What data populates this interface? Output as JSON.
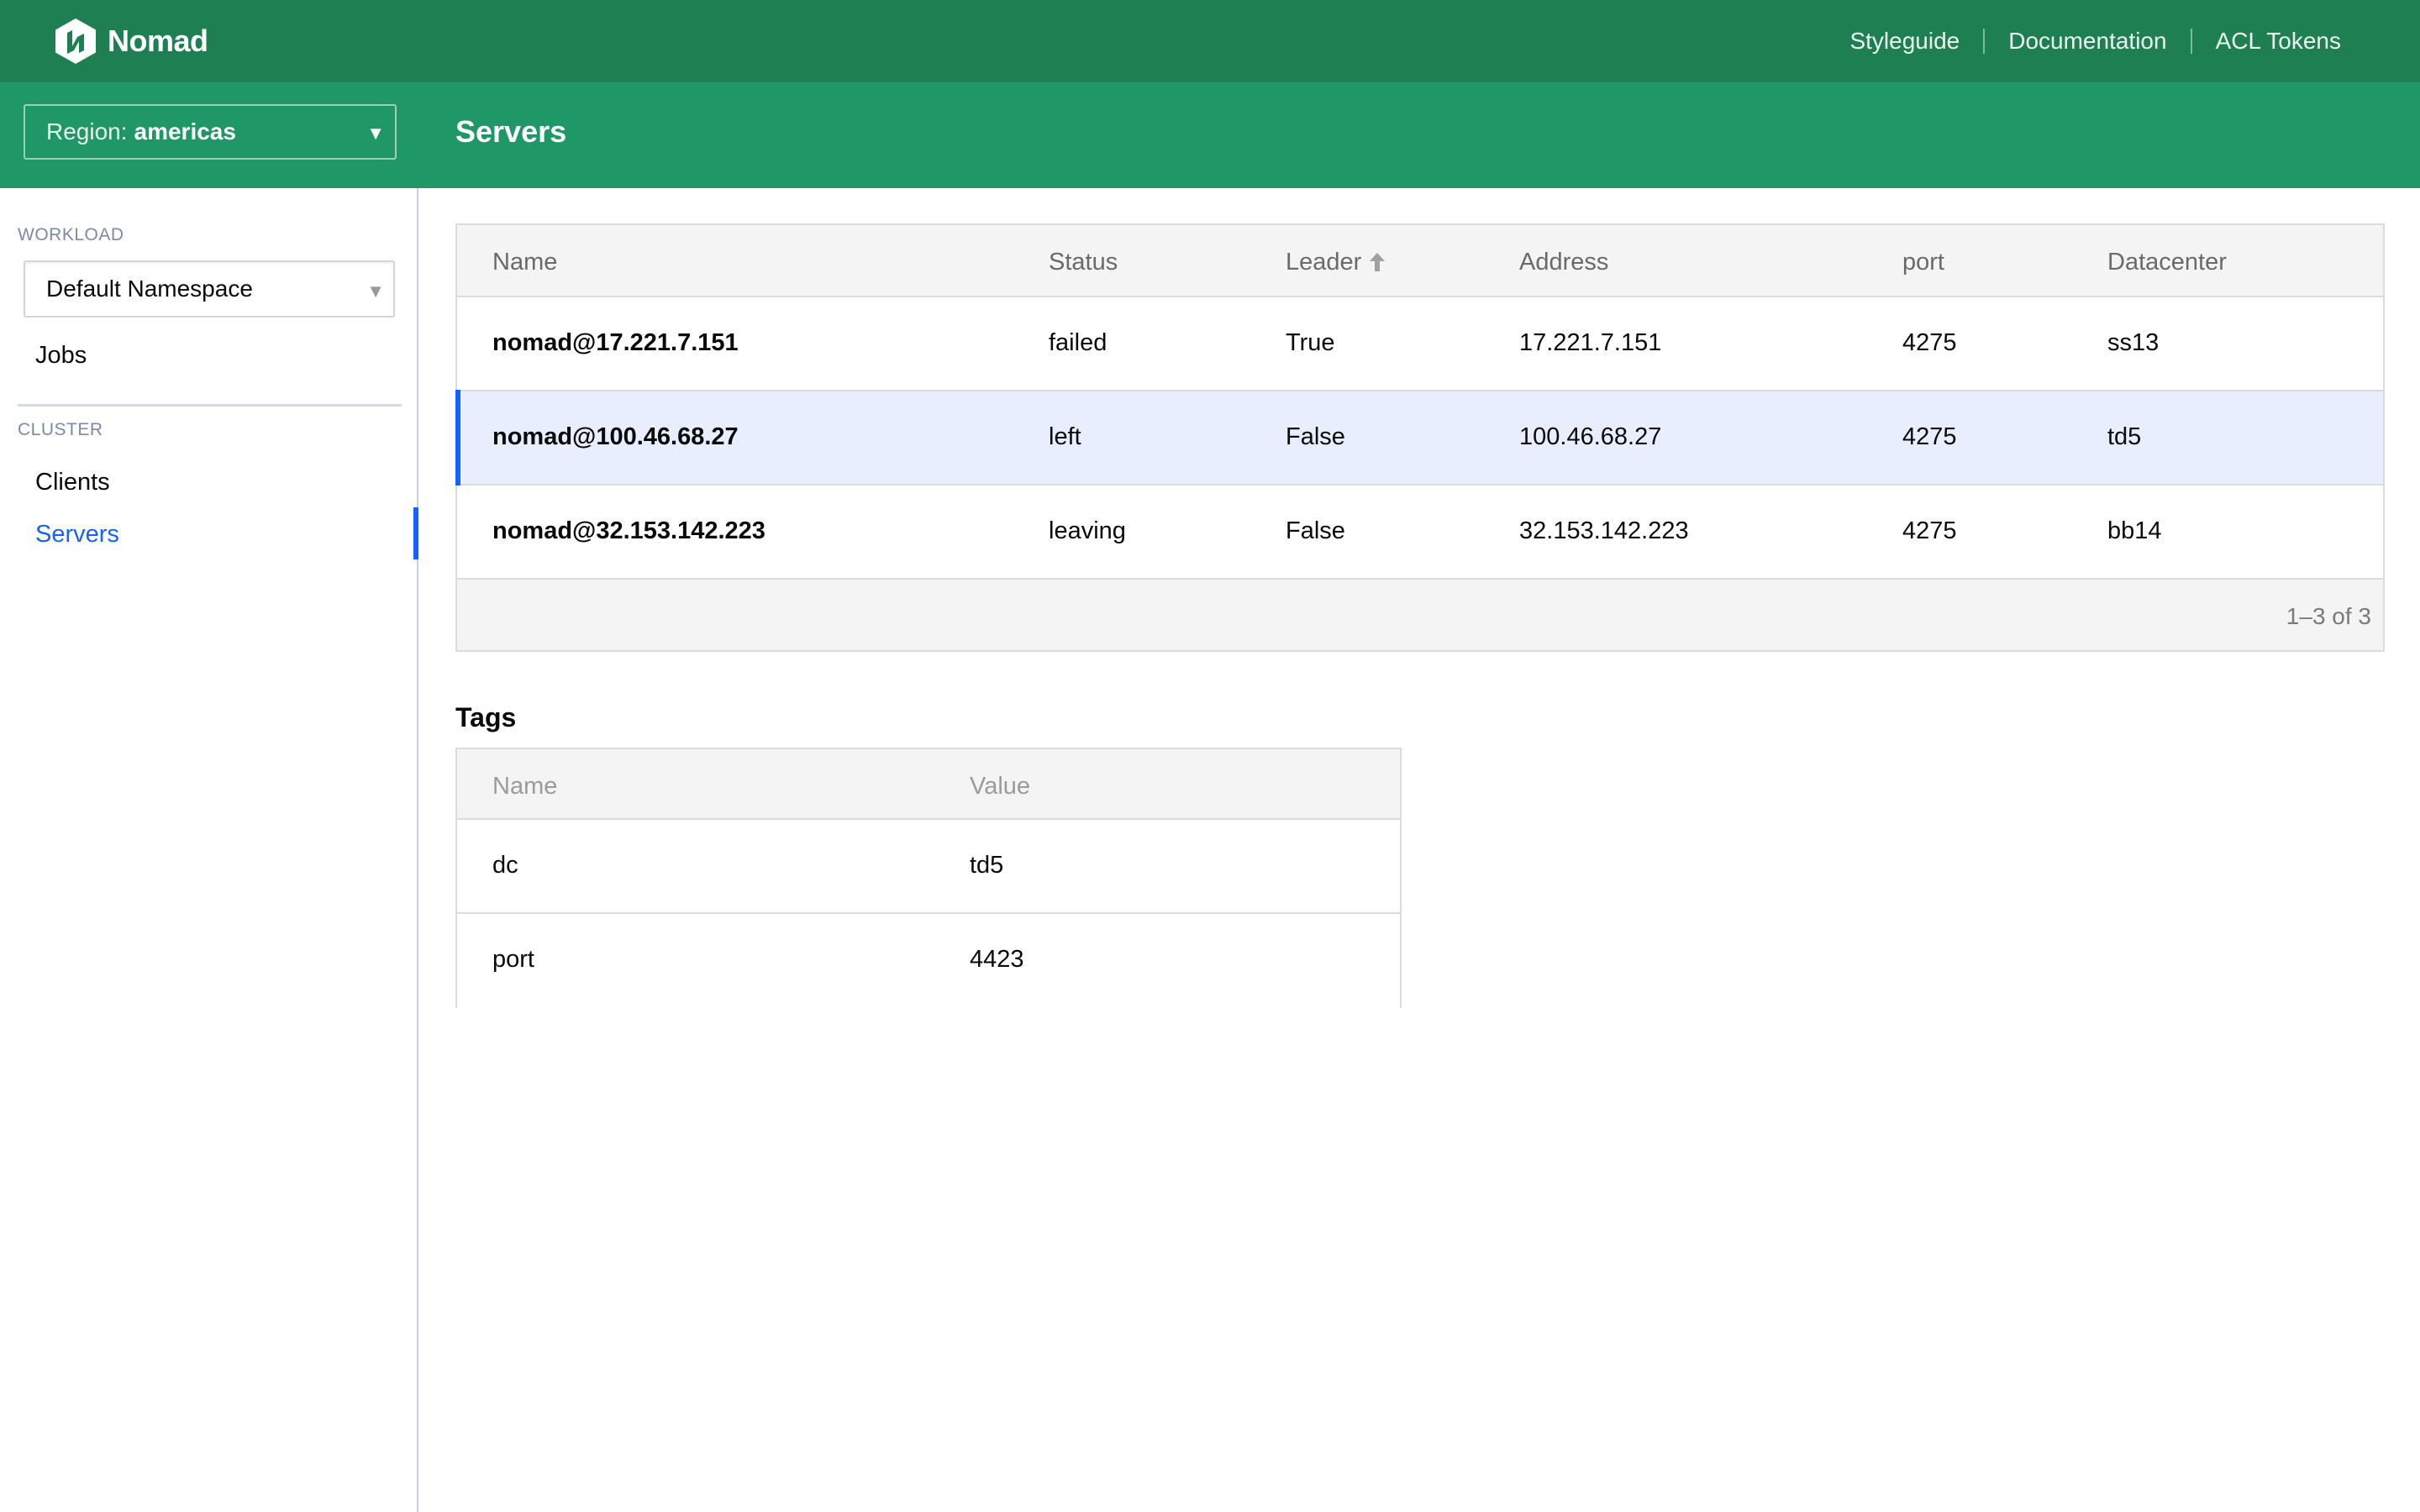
{
  "navbar": {
    "brand": "Nomad",
    "links": [
      "Styleguide",
      "Documentation",
      "ACL Tokens"
    ]
  },
  "subheader": {
    "region_label": "Region:",
    "region_value": "americas",
    "page_title": "Servers"
  },
  "sidebar": {
    "workload_label": "WORKLOAD",
    "namespace_value": "Default Namespace",
    "jobs_label": "Jobs",
    "cluster_label": "CLUSTER",
    "clients_label": "Clients",
    "servers_label": "Servers"
  },
  "servers_table": {
    "columns": [
      "Name",
      "Status",
      "Leader",
      "Address",
      "port",
      "Datacenter"
    ],
    "sorted_column": "Leader",
    "rows": [
      {
        "name": "nomad@17.221.7.151",
        "status": "failed",
        "leader": "True",
        "address": "17.221.7.151",
        "port": "4275",
        "datacenter": "ss13"
      },
      {
        "name": "nomad@100.46.68.27",
        "status": "left",
        "leader": "False",
        "address": "100.46.68.27",
        "port": "4275",
        "datacenter": "td5"
      },
      {
        "name": "nomad@32.153.142.223",
        "status": "leaving",
        "leader": "False",
        "address": "32.153.142.223",
        "port": "4275",
        "datacenter": "bb14"
      }
    ],
    "pagination": "1–3 of 3"
  },
  "tags": {
    "title": "Tags",
    "columns": [
      "Name",
      "Value"
    ],
    "rows": [
      {
        "name": "dc",
        "value": "td5"
      },
      {
        "name": "port",
        "value": "4423"
      }
    ]
  },
  "colors": {
    "navbar": "#1d7f52",
    "subheader": "#1f9767",
    "accent": "#1563ff",
    "highlight_row": "#e8eefe"
  }
}
